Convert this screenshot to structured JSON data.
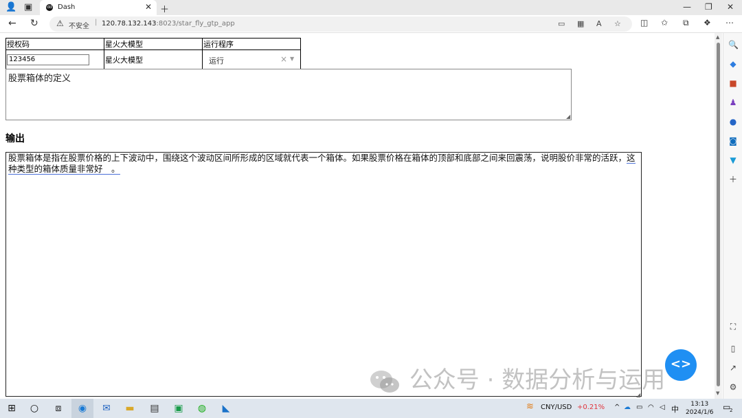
{
  "browser": {
    "tab_title": "Dash",
    "favicon_text": "dd",
    "url_security_label": "不安全",
    "url_host": "120.78.132.143",
    "url_path": ":8023/star_fly_gtp_app"
  },
  "form": {
    "header_auth": "授权码",
    "header_model": "星火大模型",
    "header_run": "运行程序",
    "auth_value": "123456",
    "model_value": "星火大模型",
    "run_selected": "运行",
    "prompt_value": "股票箱体的定义"
  },
  "output": {
    "label": "输出",
    "text_main": "股票箱体是指在股票价格的上下波动中，围绕这个波动区间所形成的区域就代表一个箱体。如果股票价格在箱体的顶部和底部之间来回震荡，说明股价非常的活跃，",
    "text_underlined": "这种类型的箱体质量非常好　。"
  },
  "fab_label": "<>",
  "watermark": "公众号 · 数据分析与运用",
  "taskbar": {
    "currency": "CNY/USD",
    "currency_change": "+0.21%",
    "ime": "中",
    "time": "13:13",
    "date": "2024/1/6",
    "notif_count": "2"
  },
  "colors": {
    "fab": "#1f8ff3",
    "currency_change": "#e0343c",
    "underline": "#4a6fd8"
  }
}
